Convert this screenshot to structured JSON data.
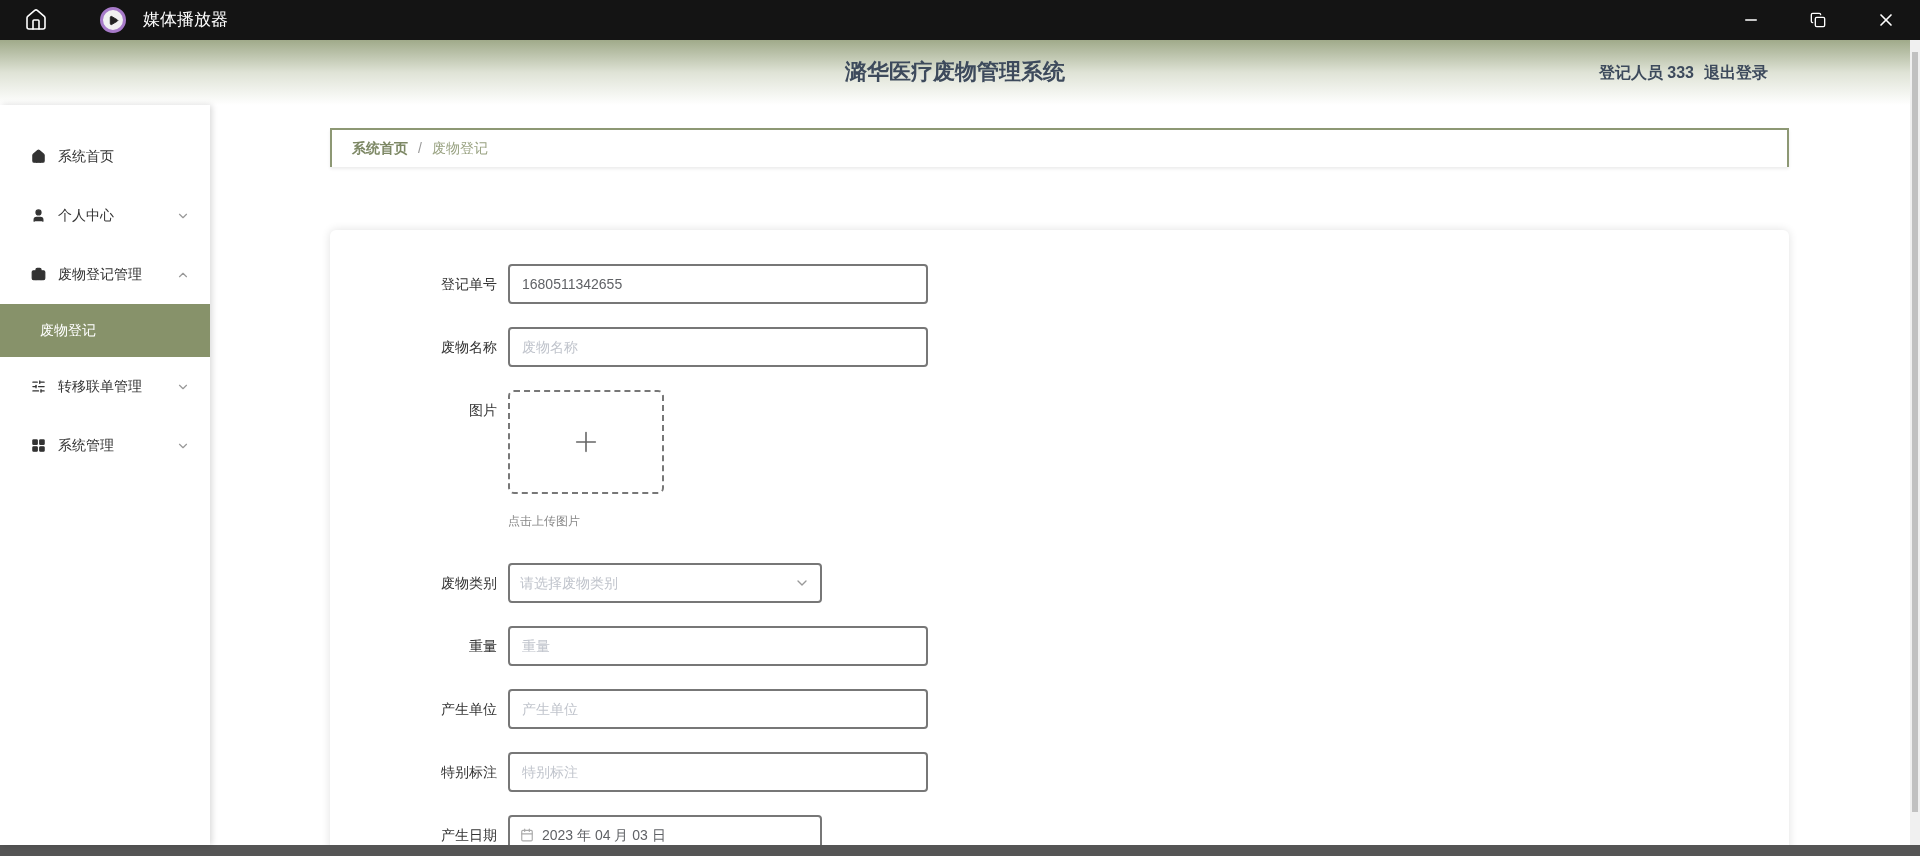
{
  "window": {
    "title": "媒体播放器"
  },
  "header": {
    "title": "潞华医疗废物管理系统",
    "user": "登记人员 333",
    "logout": "退出登录"
  },
  "sidebar": {
    "items": [
      {
        "label": "系统首页"
      },
      {
        "label": "个人中心",
        "expanded": false
      },
      {
        "label": "废物登记管理",
        "expanded": true,
        "children": [
          {
            "label": "废物登记",
            "selected": true
          }
        ]
      },
      {
        "label": "转移联单管理",
        "expanded": false
      },
      {
        "label": "系统管理",
        "expanded": false
      }
    ]
  },
  "breadcrumb": {
    "separator": "/",
    "items": [
      {
        "label": "系统首页"
      },
      {
        "label": "废物登记"
      }
    ]
  },
  "form": {
    "fields": [
      {
        "kind": "text",
        "label": "登记单号",
        "value": "1680511342655"
      },
      {
        "kind": "text",
        "label": "废物名称",
        "placeholder": "废物名称"
      },
      {
        "kind": "upload",
        "label": "图片",
        "hint": "点击上传图片"
      },
      {
        "kind": "select",
        "label": "废物类别",
        "placeholder": "请选择废物类别"
      },
      {
        "kind": "text",
        "label": "重量",
        "placeholder": "重量"
      },
      {
        "kind": "text",
        "label": "产生单位",
        "placeholder": "产生单位"
      },
      {
        "kind": "text",
        "label": "特别标注",
        "placeholder": "特别标注"
      },
      {
        "kind": "date",
        "label": "产生日期",
        "value": "2023 年 04 月 03 日"
      }
    ]
  }
}
